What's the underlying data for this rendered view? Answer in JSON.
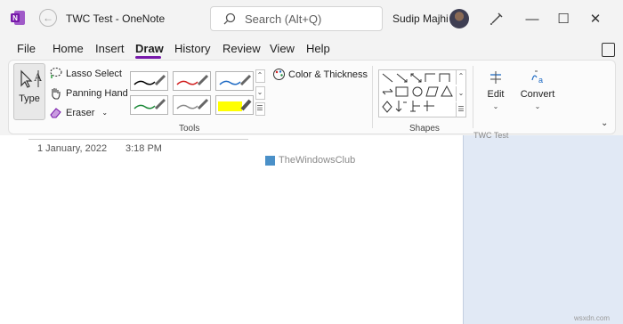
{
  "titlebar": {
    "doc_title": "TWC Test  -  OneNote",
    "search_placeholder": "Search (Alt+Q)",
    "user_name": "Sudip Majhi",
    "minimize": "—",
    "maximize": "☐",
    "close": "✕"
  },
  "menu": {
    "tabs": [
      "File",
      "Home",
      "Insert",
      "Draw",
      "History",
      "Review",
      "View",
      "Help"
    ],
    "active_tab": "Draw"
  },
  "ribbon": {
    "type_label": "Type",
    "lasso_label": "Lasso Select",
    "panning_label": "Panning Hand",
    "eraser_label": "Eraser",
    "color_thickness_label": "Color & Thickness",
    "tools_group_label": "Tools",
    "shapes_group_label": "Shapes",
    "edit_label": "Edit",
    "convert_label": "Convert",
    "pens": [
      {
        "color": "#000000",
        "kind": "pen"
      },
      {
        "color": "#d11f1f",
        "kind": "pen"
      },
      {
        "color": "#1f6bc4",
        "kind": "pen"
      },
      {
        "color": "#1e8a3a",
        "kind": "pen"
      },
      {
        "color": "#8a8a8a",
        "kind": "pen"
      },
      {
        "color": "#ffff00",
        "kind": "highlighter"
      }
    ]
  },
  "page": {
    "date": "1 January, 2022",
    "time": "3:18 PM",
    "watermark": "TheWindowsClub",
    "panel_peek": "TWC Test"
  },
  "footer_watermark": "wsxdn.com",
  "colors": {
    "accent": "#7719aa",
    "panel_bg": "#e1e9f5"
  }
}
